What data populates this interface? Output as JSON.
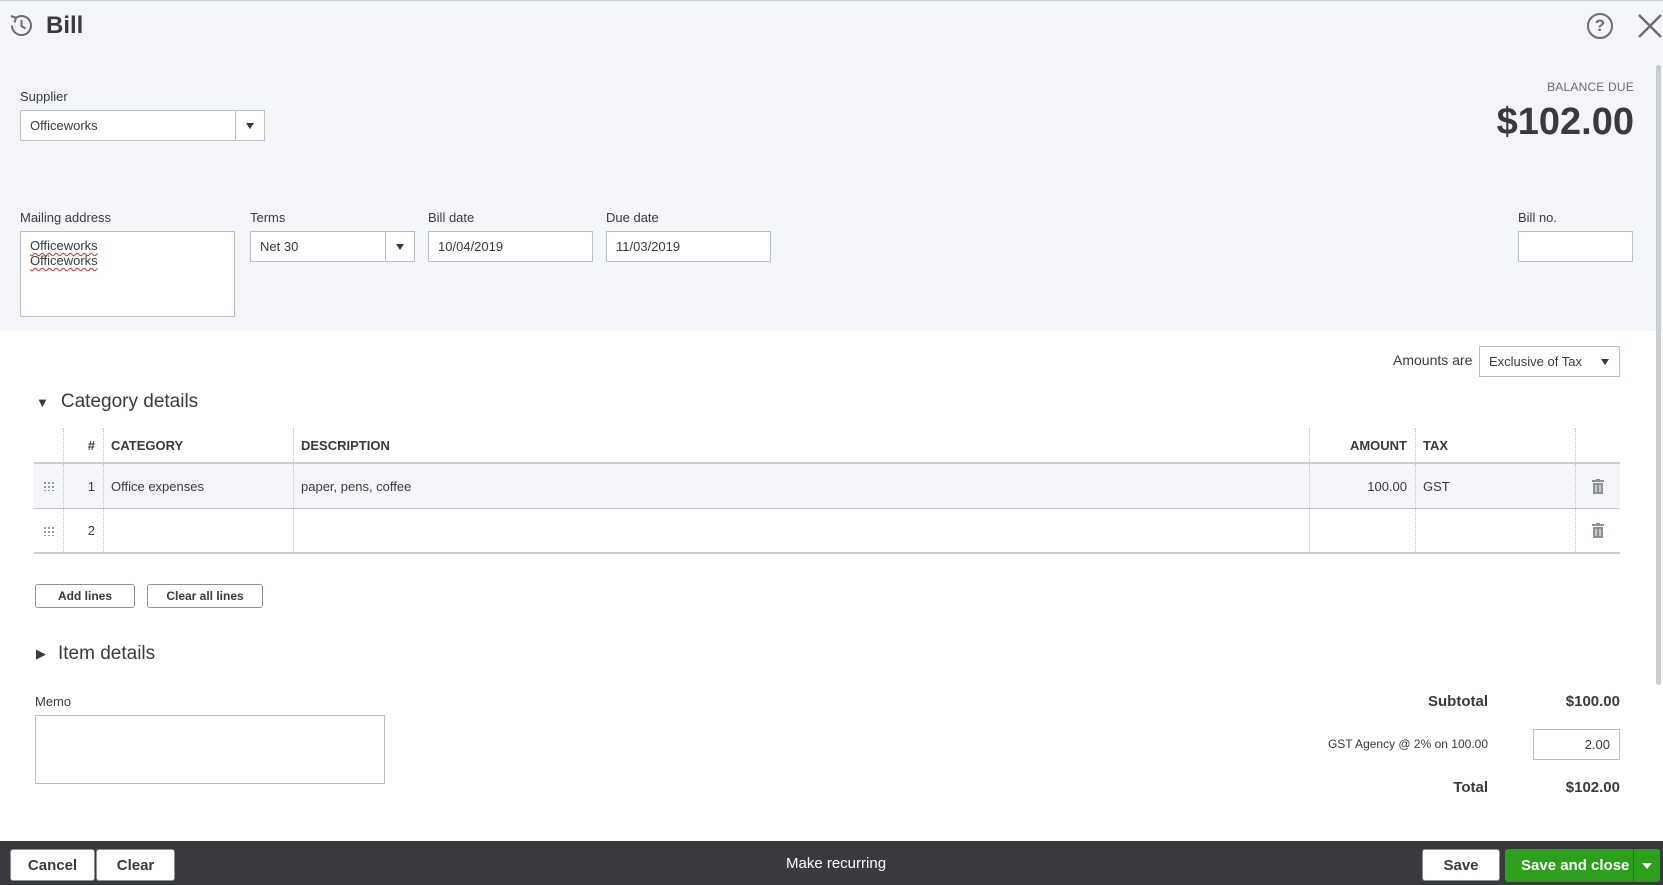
{
  "header": {
    "title": "Bill",
    "history_icon": "history-clock-icon",
    "help_icon": "help-icon",
    "help_glyph": "?",
    "close_icon": "close-icon"
  },
  "supplier": {
    "label": "Supplier",
    "value": "Officeworks"
  },
  "balance": {
    "label": "BALANCE DUE",
    "value": "$102.00"
  },
  "mailing": {
    "label": "Mailing address",
    "lines": [
      "Officeworks",
      "Officeworks"
    ]
  },
  "terms": {
    "label": "Terms",
    "value": "Net 30"
  },
  "bill_date": {
    "label": "Bill date",
    "value": "10/04/2019"
  },
  "due_date": {
    "label": "Due date",
    "value": "11/03/2019"
  },
  "bill_no": {
    "label": "Bill no.",
    "value": ""
  },
  "amounts": {
    "label": "Amounts are",
    "value": "Exclusive of Tax"
  },
  "category_section": {
    "title": "Category details",
    "arrow": "▼"
  },
  "table": {
    "headers": {
      "num": "#",
      "category": "CATEGORY",
      "description": "DESCRIPTION",
      "amount": "AMOUNT",
      "tax": "TAX"
    },
    "rows": [
      {
        "num": "1",
        "category": "Office expenses",
        "description": "paper, pens, coffee",
        "amount": "100.00",
        "tax": "GST"
      },
      {
        "num": "2",
        "category": "",
        "description": "",
        "amount": "",
        "tax": ""
      }
    ]
  },
  "buttons": {
    "add_lines": "Add lines",
    "clear_all": "Clear all lines"
  },
  "item_section": {
    "title": "Item details",
    "arrow": "▶"
  },
  "memo": {
    "label": "Memo",
    "value": ""
  },
  "totals": {
    "subtotal_label": "Subtotal",
    "subtotal_value": "$100.00",
    "tax_label": "GST Agency @ 2% on 100.00",
    "tax_value": "2.00",
    "total_label": "Total",
    "total_value": "$102.00"
  },
  "footer": {
    "cancel": "Cancel",
    "clear": "Clear",
    "make_recurring": "Make recurring",
    "save": "Save",
    "save_close": "Save and close"
  },
  "colors": {
    "accent_green": "#2ca01c",
    "footer_bg": "#393a3d",
    "panel_bg": "#f4f5f8"
  }
}
